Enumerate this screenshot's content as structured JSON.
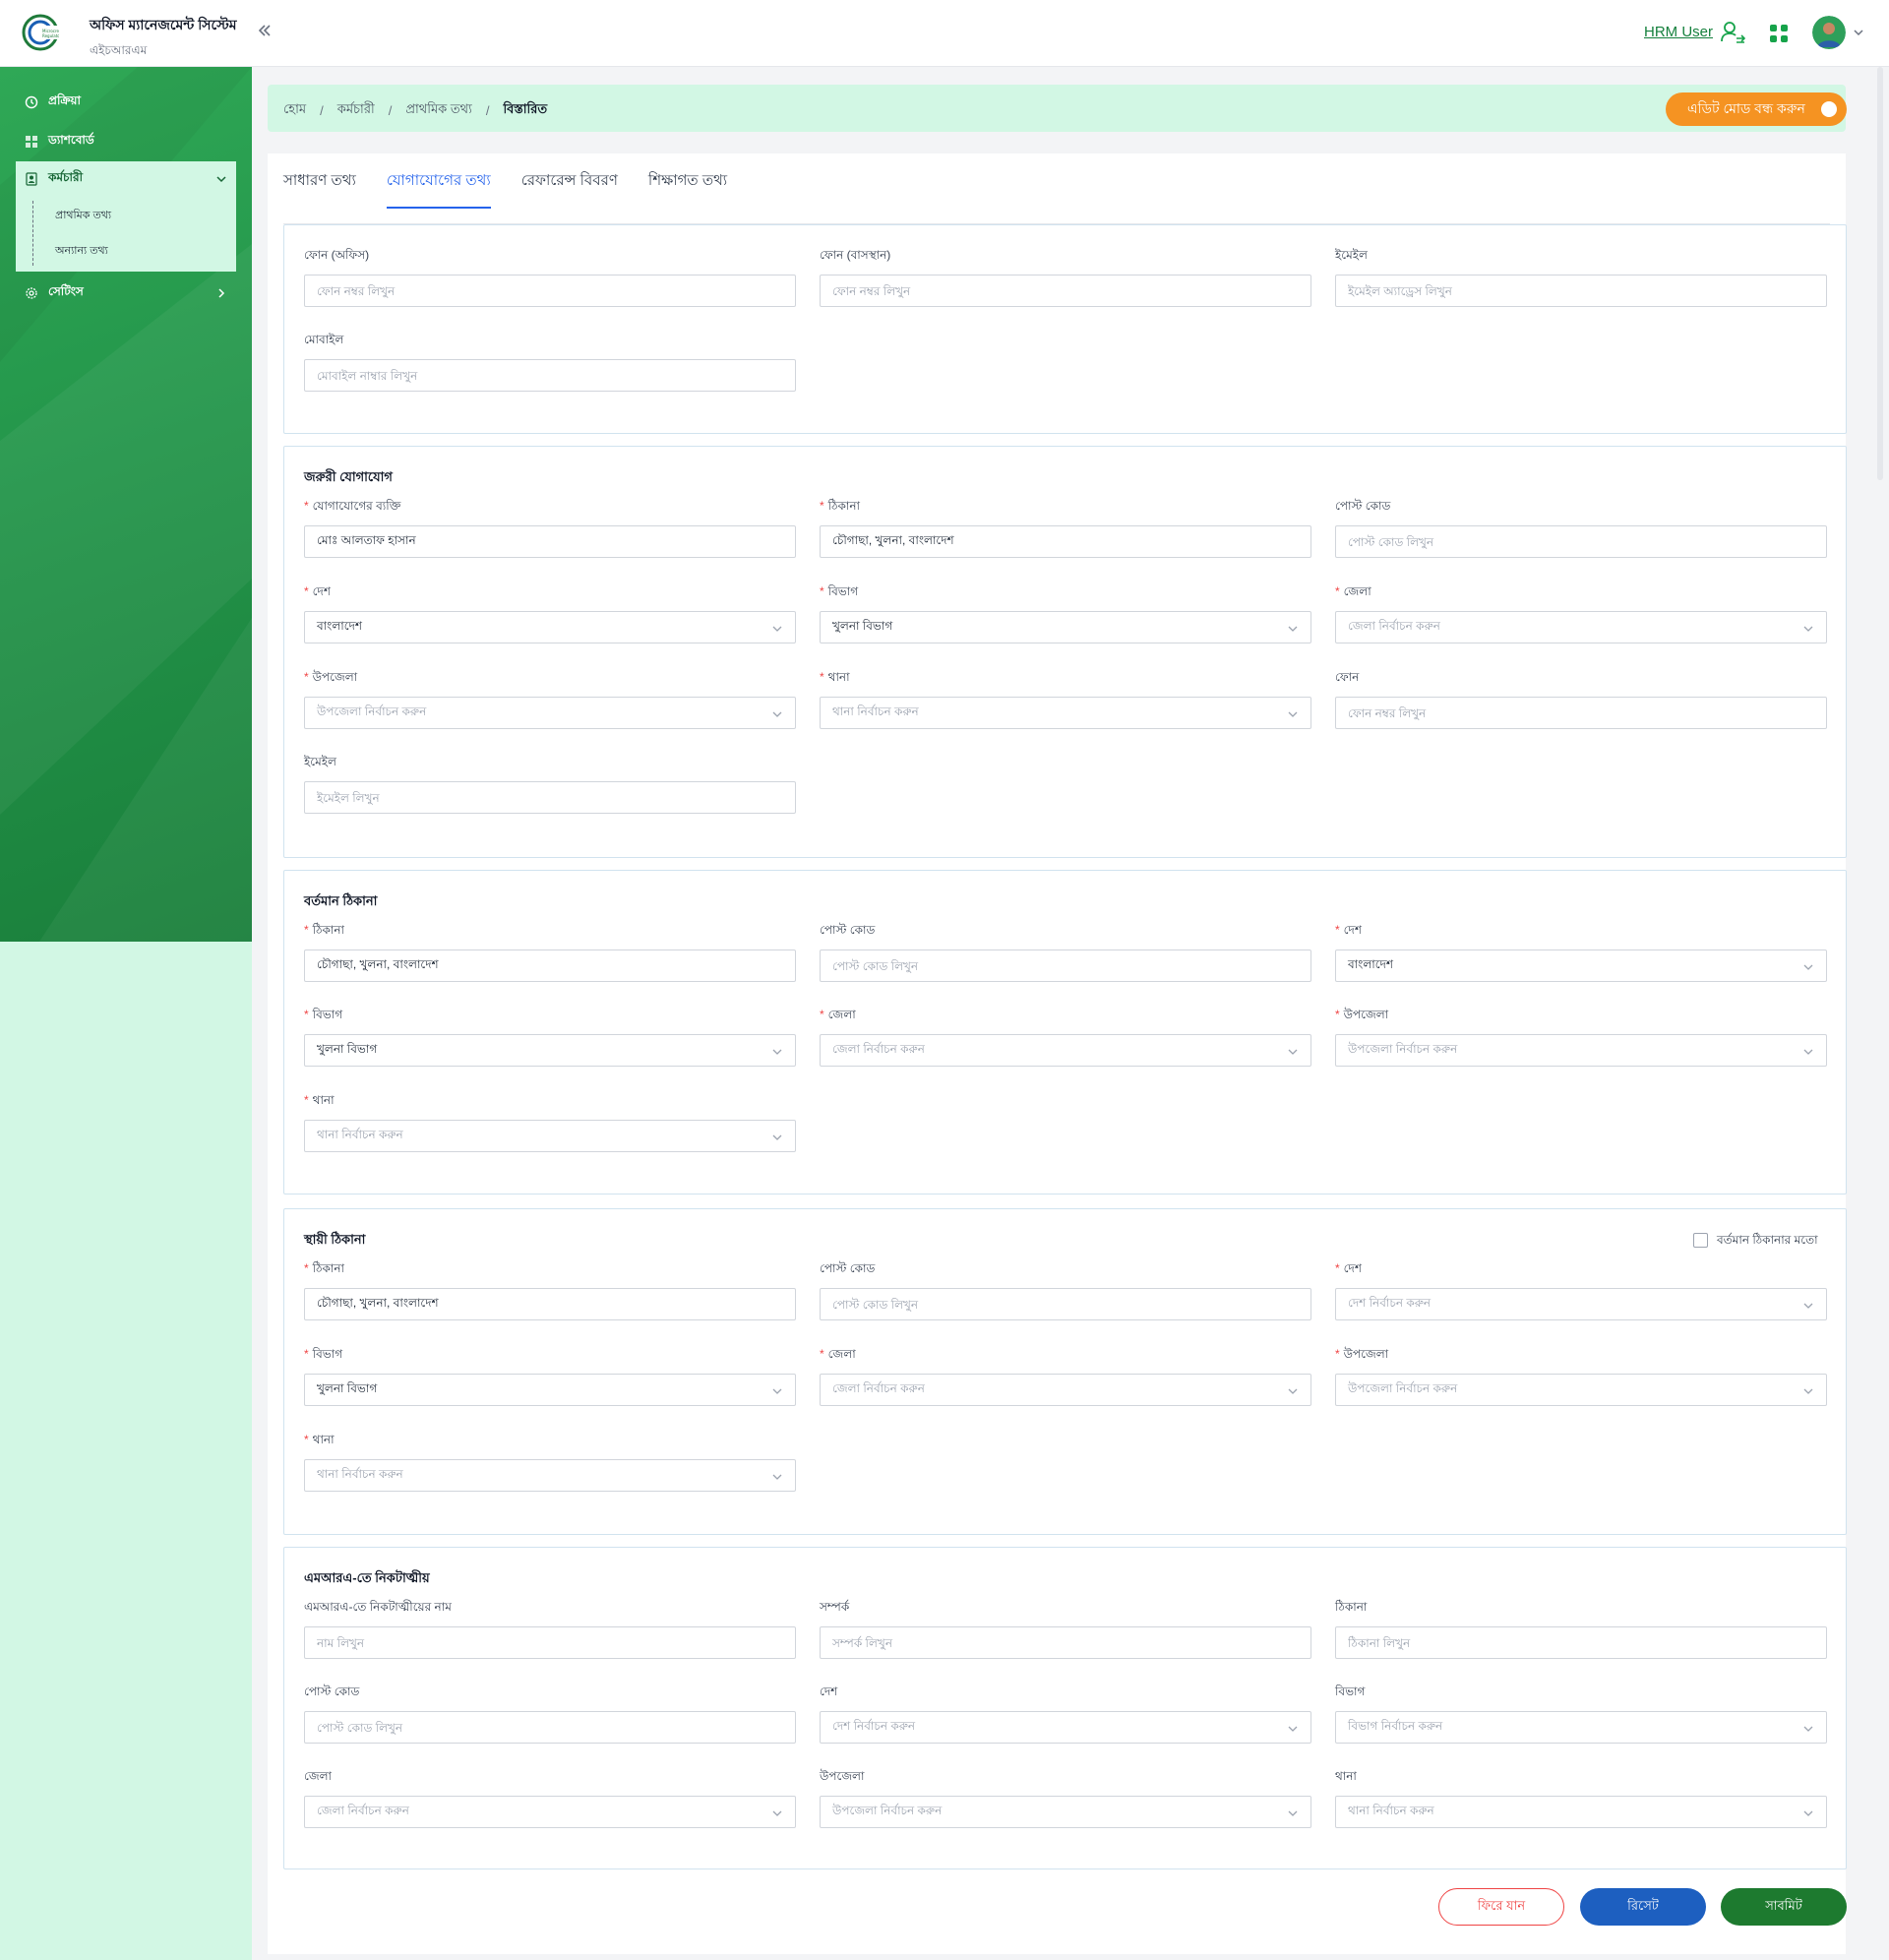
{
  "app": {
    "title": "অফিস ম্যানেজমেন্ট সিস্টেম",
    "subtitle": "এইচআরএম",
    "user_label": "HRM User"
  },
  "sidebar": {
    "items": [
      {
        "label": "প্রক্রিয়া",
        "icon": "process-icon"
      },
      {
        "label": "ড্যাশবোর্ড",
        "icon": "dashboard-icon"
      },
      {
        "label": "কর্মচারী",
        "icon": "employee-icon"
      },
      {
        "label": "সেটিংস",
        "icon": "settings-icon"
      }
    ],
    "employee_sub": [
      "প্রাথমিক তথ্য",
      "অন্যান্য তথ্য"
    ]
  },
  "breadcrumb": [
    "হোম",
    "কর্মচারী",
    "প্রাথমিক তথ্য",
    "বিস্তারিত"
  ],
  "edit_mode_label": "এডিট মোড বন্ধ করুন",
  "tabs": [
    "সাধারণ তথ্য",
    "যোগাযোগের তথ্য",
    "রেফারেন্স বিবরণ",
    "শিক্ষাগত তথ্য"
  ],
  "active_tab": "যোগাযোগের তথ্য",
  "contact": {
    "phone_office": {
      "label": "ফোন (অফিস)",
      "placeholder": "ফোন নম্বর লিখুন"
    },
    "phone_home": {
      "label": "ফোন (বাসস্থান)",
      "placeholder": "ফোন নম্বর লিখুন"
    },
    "email": {
      "label": "ইমেইল",
      "placeholder": "ইমেইল অ্যাড্রেস লিখুন"
    },
    "mobile": {
      "label": "মোবাইল",
      "placeholder": "মোবাইল নাম্বার লিখুন"
    }
  },
  "emergency": {
    "title": "জরুরী যোগাযোগ",
    "person": {
      "label": "যোগাযোগের ব্যক্তি",
      "value": "মোঃ আলতাফ হাসান"
    },
    "address": {
      "label": "ঠিকানা",
      "value": "চৌগাছা, খুলনা, বাংলাদেশ"
    },
    "postcode": {
      "label": "পোস্ট কোড",
      "placeholder": "পোস্ট কোড লিখুন"
    },
    "country": {
      "label": "দেশ",
      "value": "বাংলাদেশ"
    },
    "division": {
      "label": "বিভাগ",
      "value": "খুলনা বিভাগ"
    },
    "district": {
      "label": "জেলা",
      "placeholder": "জেলা নির্বাচন করুন"
    },
    "upazila": {
      "label": "উপজেলা",
      "placeholder": "উপজেলা নির্বাচন করুন"
    },
    "thana": {
      "label": "থানা",
      "placeholder": "থানা নির্বাচন করুন"
    },
    "phone": {
      "label": "ফোন",
      "placeholder": "ফোন নম্বর লিখুন"
    },
    "email": {
      "label": "ইমেইল",
      "placeholder": "ইমেইল লিখুন"
    }
  },
  "present": {
    "title": "বর্তমান ঠিকানা",
    "address": {
      "label": "ঠিকানা",
      "value": "চৌগাছা, খুলনা, বাংলাদেশ"
    },
    "postcode": {
      "label": "পোস্ট কোড",
      "placeholder": "পোস্ট কোড লিখুন"
    },
    "country": {
      "label": "দেশ",
      "value": "বাংলাদেশ"
    },
    "division": {
      "label": "বিভাগ",
      "value": "খুলনা বিভাগ"
    },
    "district": {
      "label": "জেলা",
      "placeholder": "জেলা নির্বাচন করুন"
    },
    "upazila": {
      "label": "উপজেলা",
      "placeholder": "উপজেলা নির্বাচন করুন"
    },
    "thana": {
      "label": "থানা",
      "placeholder": "থানা নির্বাচন করুন"
    }
  },
  "permanent": {
    "title": "স্থায়ী ঠিকানা",
    "same_as_present": "বর্তমান ঠিকানার মতো",
    "address": {
      "label": "ঠিকানা",
      "value": "চৌগাছা, খুলনা, বাংলাদেশ"
    },
    "postcode": {
      "label": "পোস্ট কোড",
      "placeholder": "পোস্ট কোড লিখুন"
    },
    "country": {
      "label": "দেশ",
      "placeholder": "দেশ নির্বাচন করুন"
    },
    "division": {
      "label": "বিভাগ",
      "value": "খুলনা বিভাগ"
    },
    "district": {
      "label": "জেলা",
      "placeholder": "জেলা নির্বাচন করুন"
    },
    "upazila": {
      "label": "উপজেলা",
      "placeholder": "উপজেলা নির্বাচন করুন"
    },
    "thana": {
      "label": "থানা",
      "placeholder": "থানা নির্বাচন করুন"
    }
  },
  "relative": {
    "title": "এমআরএ-তে নিকটাত্মীয়",
    "name": {
      "label": "এমআরএ-তে নিকটাত্মীয়ের নাম",
      "placeholder": "নাম লিখুন"
    },
    "relation": {
      "label": "সম্পর্ক",
      "placeholder": "সম্পর্ক লিখুন"
    },
    "address": {
      "label": "ঠিকানা",
      "placeholder": "ঠিকানা লিখুন"
    },
    "postcode": {
      "label": "পোস্ট কোড",
      "placeholder": "পোস্ট কোড লিখুন"
    },
    "country": {
      "label": "দেশ",
      "placeholder": "দেশ নির্বাচন করুন"
    },
    "division": {
      "label": "বিভাগ",
      "placeholder": "বিভাগ নির্বাচন করুন"
    },
    "district": {
      "label": "জেলা",
      "placeholder": "জেলা নির্বাচন করুন"
    },
    "upazila": {
      "label": "উপজেলা",
      "placeholder": "উপজেলা নির্বাচন করুন"
    },
    "thana": {
      "label": "থানা",
      "placeholder": "থানা নির্বাচন করুন"
    }
  },
  "buttons": {
    "back": "ফিরে যান",
    "reset": "রিসেট",
    "submit": "সাবমিট"
  },
  "colors": {
    "primary_green": "#23954a",
    "light_green": "#d2f7e4",
    "accent_orange": "#f59322",
    "link_blue": "#2563eb",
    "reset_blue": "#1d5fc0",
    "submit_green": "#1d7a2f",
    "required_red": "#ef4444"
  }
}
